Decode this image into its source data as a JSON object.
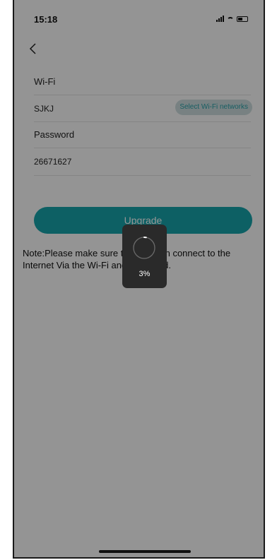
{
  "status_bar": {
    "time": "15:18",
    "icons": [
      "signal-icon",
      "wifi-icon",
      "battery-icon"
    ]
  },
  "nav": {
    "back_icon": "chevron-left-icon"
  },
  "form": {
    "wifi_label": "Wi-Fi",
    "wifi_value": "SJKJ",
    "select_wifi_label": "Select Wi-Fi networks",
    "password_label": "Password",
    "password_value": "26671627"
  },
  "upgrade_button_label": "Upgrade",
  "note": "Note:Please make sure the light can connect to the Internet Via the Wi-Fi and password.",
  "loader": {
    "progress_text": "3%",
    "progress": 0.03
  },
  "colors": {
    "accent": "#17a5ac",
    "overlay": "#000000",
    "loader_bg": "#2a2a2a"
  }
}
